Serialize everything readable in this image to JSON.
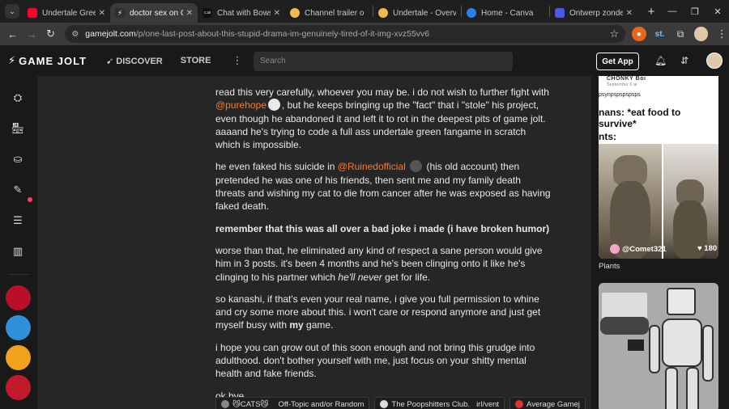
{
  "browser": {
    "tabs": [
      {
        "title": "Undertale Green",
        "favicon_color": "#ff0033",
        "active": false
      },
      {
        "title": "doctor sex on Ga",
        "favicon_color": "#2f2f2f",
        "active": true
      },
      {
        "title": "Chat with Bowse",
        "favicon_color": "#101010",
        "active": false
      },
      {
        "title": "Channel trailer o",
        "favicon_color": "#f2b84b",
        "active": false
      },
      {
        "title": "Undertale - Overv",
        "favicon_color": "#f2b84b",
        "active": false
      },
      {
        "title": "Home - Canva",
        "favicon_color": "#2b7de9",
        "active": false
      },
      {
        "title": "Ontwerp zonder",
        "favicon_color": "#4b58f0",
        "active": false
      }
    ],
    "url_host": "gamejolt.com",
    "url_path": "/p/one-last-post-about-this-stupid-drama-im-genuinely-tired-of-it-img-xvz55vv6"
  },
  "header": {
    "logo": "GAME JOLT",
    "nav": [
      "DISCOVER",
      "STORE"
    ],
    "search_placeholder": "Search",
    "get_app": "Get App"
  },
  "post": {
    "p1_a": "read this very carefully, whoever you may be. i do not wish to further fight with ",
    "p1_mention": "@purehope",
    "p1_b": ", but he keeps bringing up the \"fact\" that i \"stole\" his project, even though he abandoned it and left it to rot in the deepest pits of game jolt. aaaand he's trying to code a full ass undertale green fangame in scratch which is impossible.",
    "p2_a": "he even faked his suicide in ",
    "p2_mention": "@Ruinedofficial",
    "p2_b": " (his old account) then pretended he was one of his friends, then sent me and my family death threats and wishing my cat to die from cancer after he was exposed as having faked death.",
    "p3": "remember that this was all over a bad joke i made (i have broken humor)",
    "p4_a": "worse than that, he eliminated any kind of respect a sane person would give him in 3 posts. it's been 4 months and he's been clinging onto it like he's clinging to his partner which ",
    "p4_em": "he'll never",
    "p4_b": " get for life.",
    "p5_a": "so kanashi, if that's even your real name, i give you full permission to whine and cry some more about this. i won't care or respond anymore and just get myself busy with ",
    "p5_strong": "my",
    "p5_b": " game.",
    "p6": "i hope you can grow out of this soon enough and not bring this grudge into adulthood. don't bother yourself with me, just focus on your shitty mental health and fake friends.",
    "p7": "ok bye",
    "tags": [
      "😼CATS😼",
      "Off-Topic and/or Random",
      "The Poopshitters Club.",
      "irl/vent",
      "Average Gamej"
    ]
  },
  "right": {
    "card1": {
      "meme_author": "CHONKY Boi",
      "meme_date": "September 6 at",
      "meme_text1": "psynpspspspsps",
      "meme_text2": "nans: *eat food to survive*",
      "meme_text3": "nts:",
      "user": "@Comet321",
      "likes": "180"
    },
    "card1_title": "Plants"
  }
}
